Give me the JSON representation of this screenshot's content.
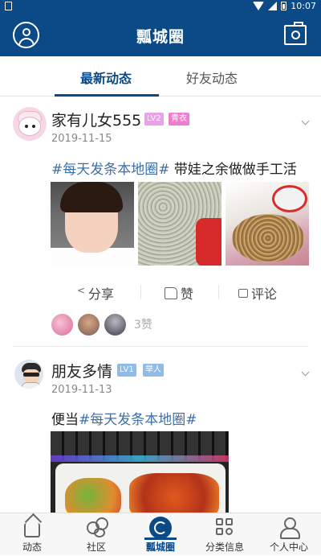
{
  "status_bar": {
    "time": "10:07"
  },
  "header": {
    "title": "瓢城圈"
  },
  "tabs": [
    {
      "label": "最新动态",
      "active": true
    },
    {
      "label": "好友动态",
      "active": false
    }
  ],
  "posts": [
    {
      "username": "家有儿女555",
      "level_badge": "LV2",
      "title_badge": "青衣",
      "date": "2019-11-15",
      "tag": "#每天发条本地圈#",
      "text": " 带娃之余做做手工活",
      "actions": {
        "share": "分享",
        "like": "赞",
        "comment": "评论"
      },
      "like_count": "3赞"
    },
    {
      "username": "朋友多情",
      "level_badge": "LV1",
      "title_badge": "举人",
      "date": "2019-11-13",
      "prefix": "便当",
      "tag": "#每天发条本地圈#"
    }
  ],
  "colors": {
    "brand": "#0b4a86",
    "tag": "#3e6fa8",
    "lv2_badge": "#e9a2e7",
    "qingyi_badge": "#f07ed0",
    "lv1_badge": "#8fbbe6",
    "juren_badge": "#8fbbe6"
  },
  "bottom_nav": [
    {
      "label": "动态",
      "icon": "home-icon"
    },
    {
      "label": "社区",
      "icon": "community-icon"
    },
    {
      "label": "瓢城圈",
      "icon": "circle-icon",
      "active": true
    },
    {
      "label": "分类信息",
      "icon": "category-icon"
    },
    {
      "label": "个人中心",
      "icon": "user-icon"
    }
  ]
}
